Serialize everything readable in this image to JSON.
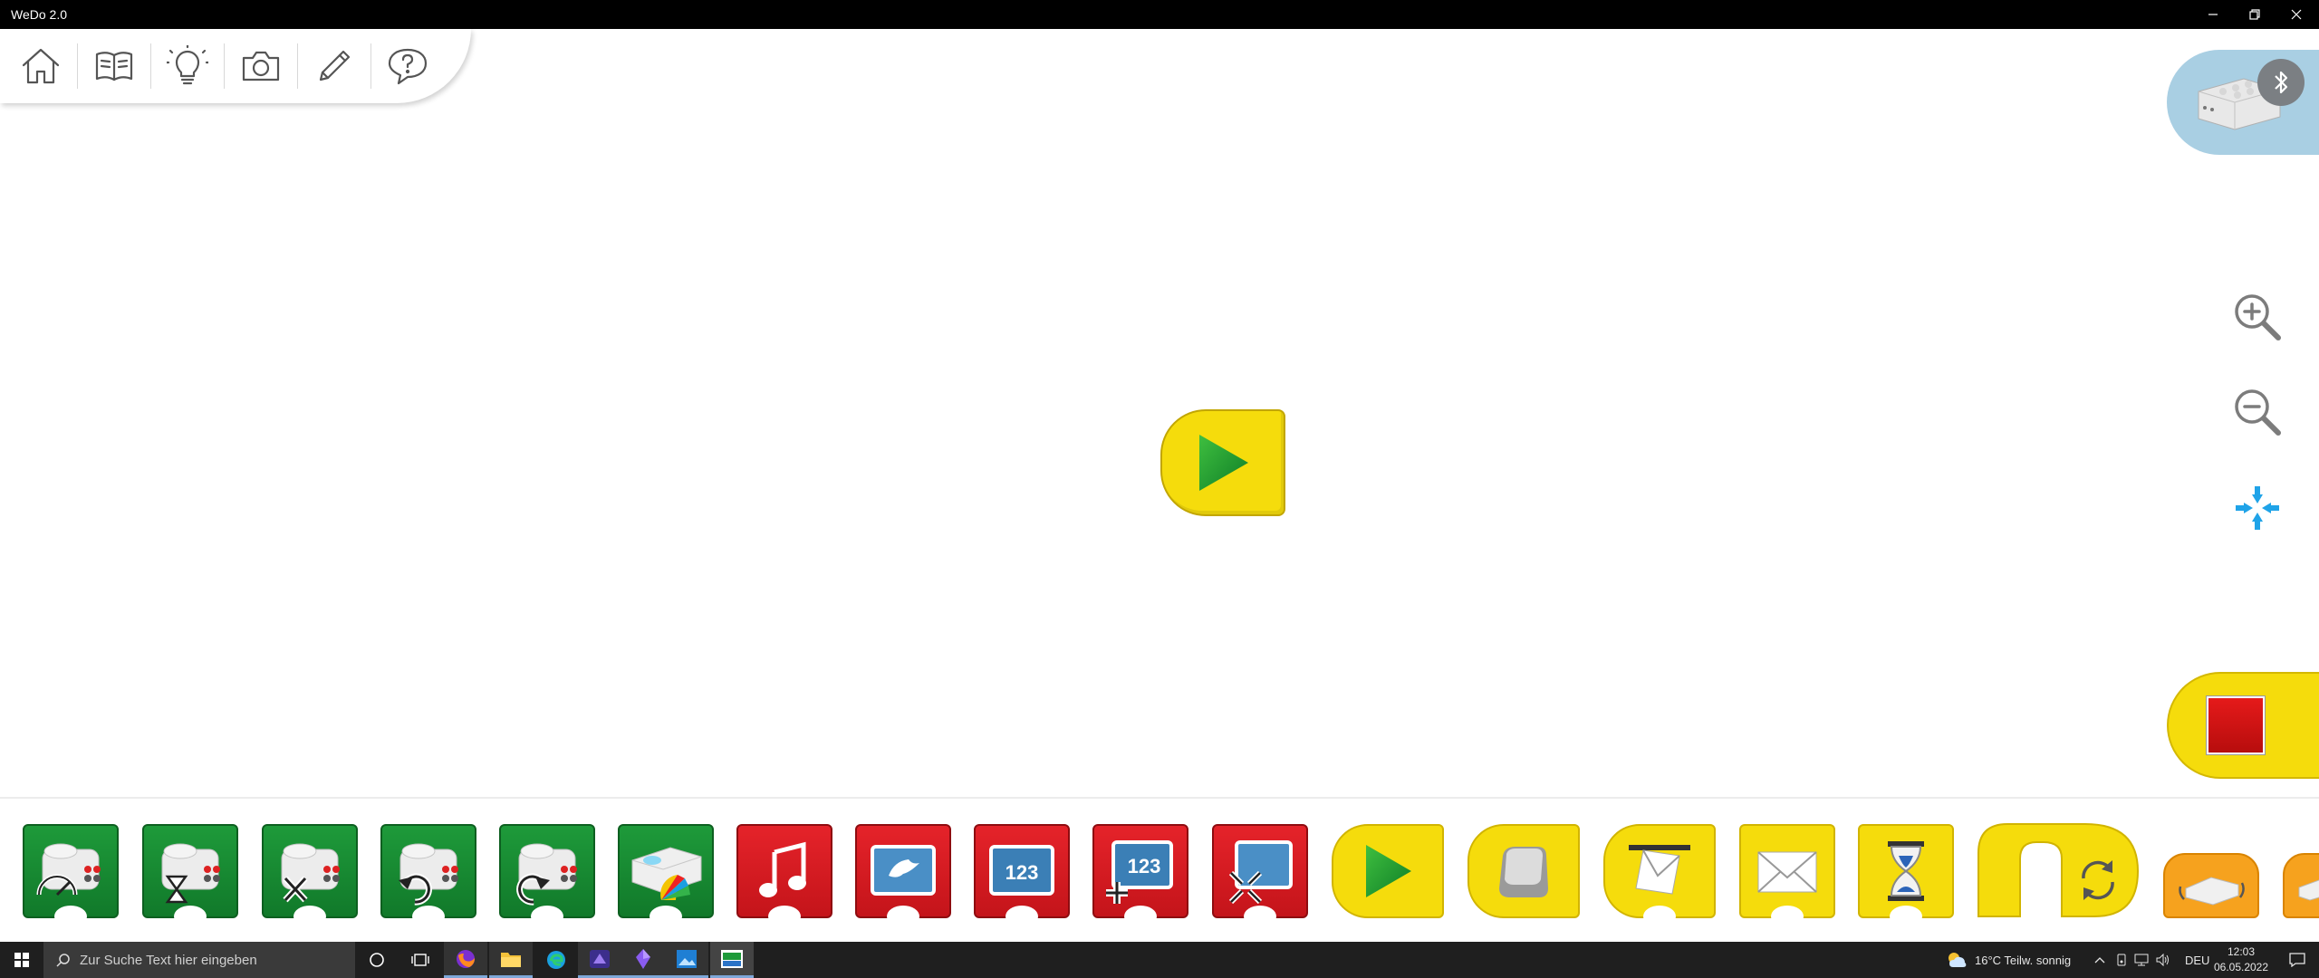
{
  "window": {
    "title": "WeDo 2.0"
  },
  "toolbar": {
    "items": [
      {
        "name": "home",
        "icon": "home-icon"
      },
      {
        "name": "documentation",
        "icon": "book-icon"
      },
      {
        "name": "projects",
        "icon": "lightbulb-icon"
      },
      {
        "name": "camera",
        "icon": "camera-icon"
      },
      {
        "name": "edit",
        "icon": "pencil-icon"
      },
      {
        "name": "help",
        "icon": "help-icon"
      }
    ]
  },
  "hub": {
    "icon": "smarthub-icon",
    "status_icon": "bluetooth-icon"
  },
  "zoom": {
    "in_icon": "zoom-in-icon",
    "out_icon": "zoom-out-icon",
    "fit_icon": "fit-to-screen-icon"
  },
  "canvas": {
    "blocks": [
      {
        "type": "start",
        "icon": "play-icon"
      }
    ]
  },
  "stop": {
    "icon": "stop-icon"
  },
  "palette": {
    "blocks": [
      {
        "name": "motor-power",
        "color": "green"
      },
      {
        "name": "motor-on-for",
        "color": "green"
      },
      {
        "name": "motor-off",
        "color": "green"
      },
      {
        "name": "motor-direction-ccw",
        "color": "green"
      },
      {
        "name": "motor-direction-cw",
        "color": "green"
      },
      {
        "name": "hub-light",
        "color": "green"
      },
      {
        "name": "play-sound",
        "color": "red"
      },
      {
        "name": "display-background",
        "color": "red"
      },
      {
        "name": "display-text",
        "color": "red",
        "label": "123"
      },
      {
        "name": "display-add",
        "color": "red",
        "label": "123"
      },
      {
        "name": "display-size",
        "color": "red"
      },
      {
        "name": "start",
        "color": "yellow"
      },
      {
        "name": "start-on-key",
        "color": "yellow"
      },
      {
        "name": "start-on-message",
        "color": "yellow"
      },
      {
        "name": "send-message",
        "color": "yellow"
      },
      {
        "name": "wait-for",
        "color": "yellow"
      },
      {
        "name": "repeat",
        "color": "yellow"
      },
      {
        "name": "tilt-sensor",
        "color": "orange"
      },
      {
        "name": "motion-sensor",
        "color": "orange"
      }
    ]
  },
  "taskbar": {
    "search_placeholder": "Zur Suche Text hier eingeben",
    "weather": "16°C  Teilw. sonnig",
    "language": "DEU",
    "time": "12:03",
    "date": "06.05.2022"
  }
}
